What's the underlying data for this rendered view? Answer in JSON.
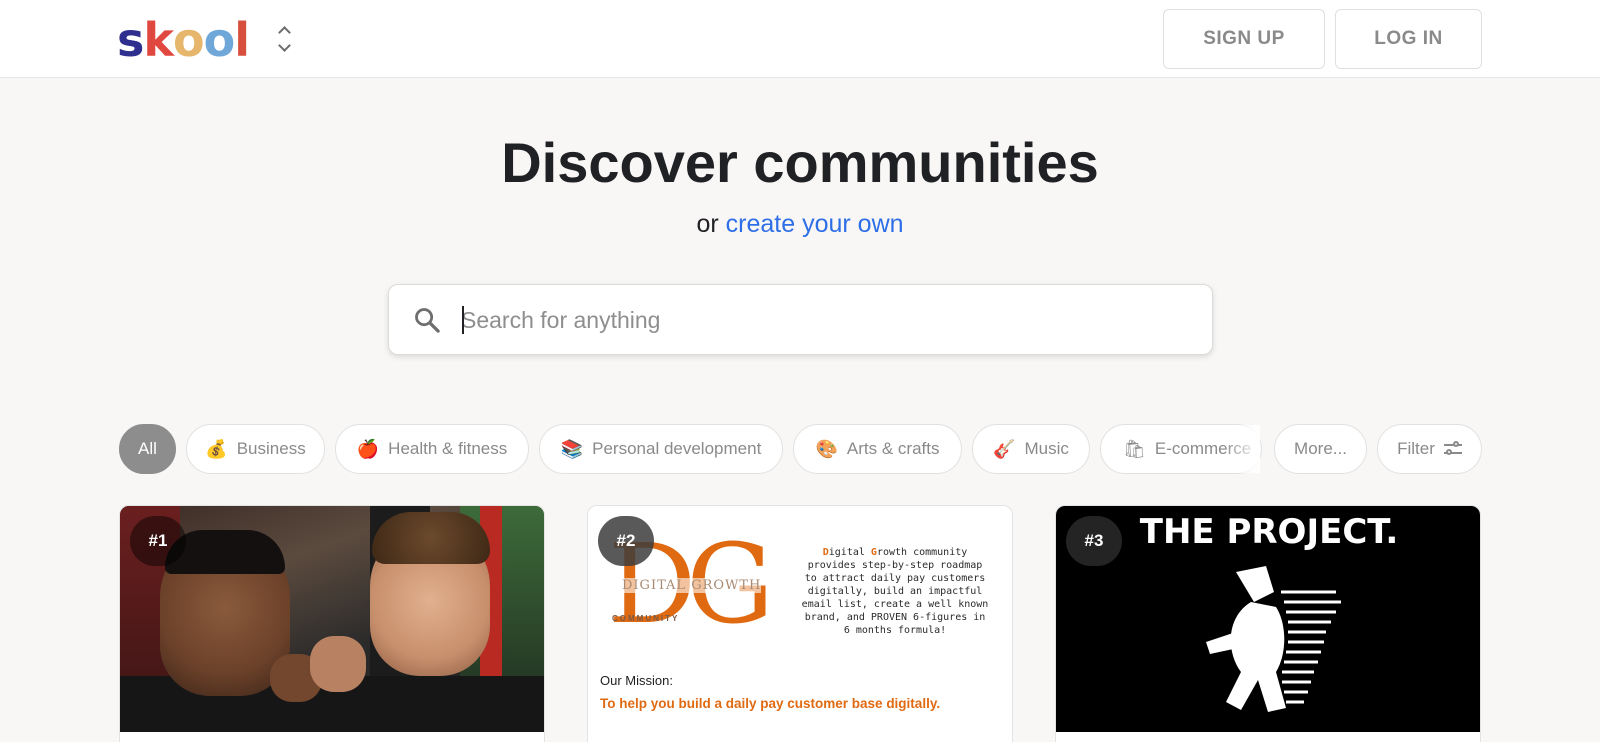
{
  "header": {
    "logo_letters": [
      {
        "ch": "s",
        "color": "#2f2f8f"
      },
      {
        "ch": "k",
        "color": "#e0483f"
      },
      {
        "ch": "o",
        "color": "#e5b66b"
      },
      {
        "ch": "o",
        "color": "#6fa7d9"
      },
      {
        "ch": "l",
        "color": "#d6503d"
      }
    ],
    "switcher_icon": "chevron-up-down-icon",
    "signup_label": "SIGN UP",
    "login_label": "LOG IN"
  },
  "hero": {
    "title": "Discover communities",
    "or_text": "or",
    "create_link": "create your own"
  },
  "search": {
    "icon": "search-icon",
    "placeholder": "Search for anything",
    "value": ""
  },
  "categories": [
    {
      "label": "All",
      "emoji": "",
      "active": true
    },
    {
      "label": "Business",
      "emoji": "💰",
      "active": false
    },
    {
      "label": "Health & fitness",
      "emoji": "🍎",
      "active": false
    },
    {
      "label": "Personal development",
      "emoji": "📚",
      "active": false
    },
    {
      "label": "Arts & crafts",
      "emoji": "🎨",
      "active": false
    },
    {
      "label": "Music",
      "emoji": "🎸",
      "active": false
    },
    {
      "label": "E-commerce",
      "emoji": "🛍",
      "active": false
    },
    {
      "label": "More...",
      "emoji": "",
      "active": false
    },
    {
      "label": "Filter",
      "emoji": "",
      "active": false
    }
  ],
  "cards": [
    {
      "rank": "#1"
    },
    {
      "rank": "#2",
      "logo_letters": "DG",
      "logo_title": "DIGITAL GROWTH",
      "logo_sub": "COMMUNITY",
      "description_lead_1": "D",
      "description_mid_1": "igital ",
      "description_lead_2": "G",
      "description_rest": "rowth community provides step-by-step roadmap to attract daily pay customers digitally, build an impactful email list, create a well known brand, and PROVEN 6-figures in 6 months formula!",
      "mission_label": "Our Mission:",
      "mission_text": "To help you build a daily pay customer base digitally."
    },
    {
      "rank": "#3",
      "title": "THE PROJECT."
    }
  ],
  "colors": {
    "accent_link": "#2e6ee6",
    "active_pill": "#8d8d8d",
    "brand_orange": "#e06a12"
  }
}
